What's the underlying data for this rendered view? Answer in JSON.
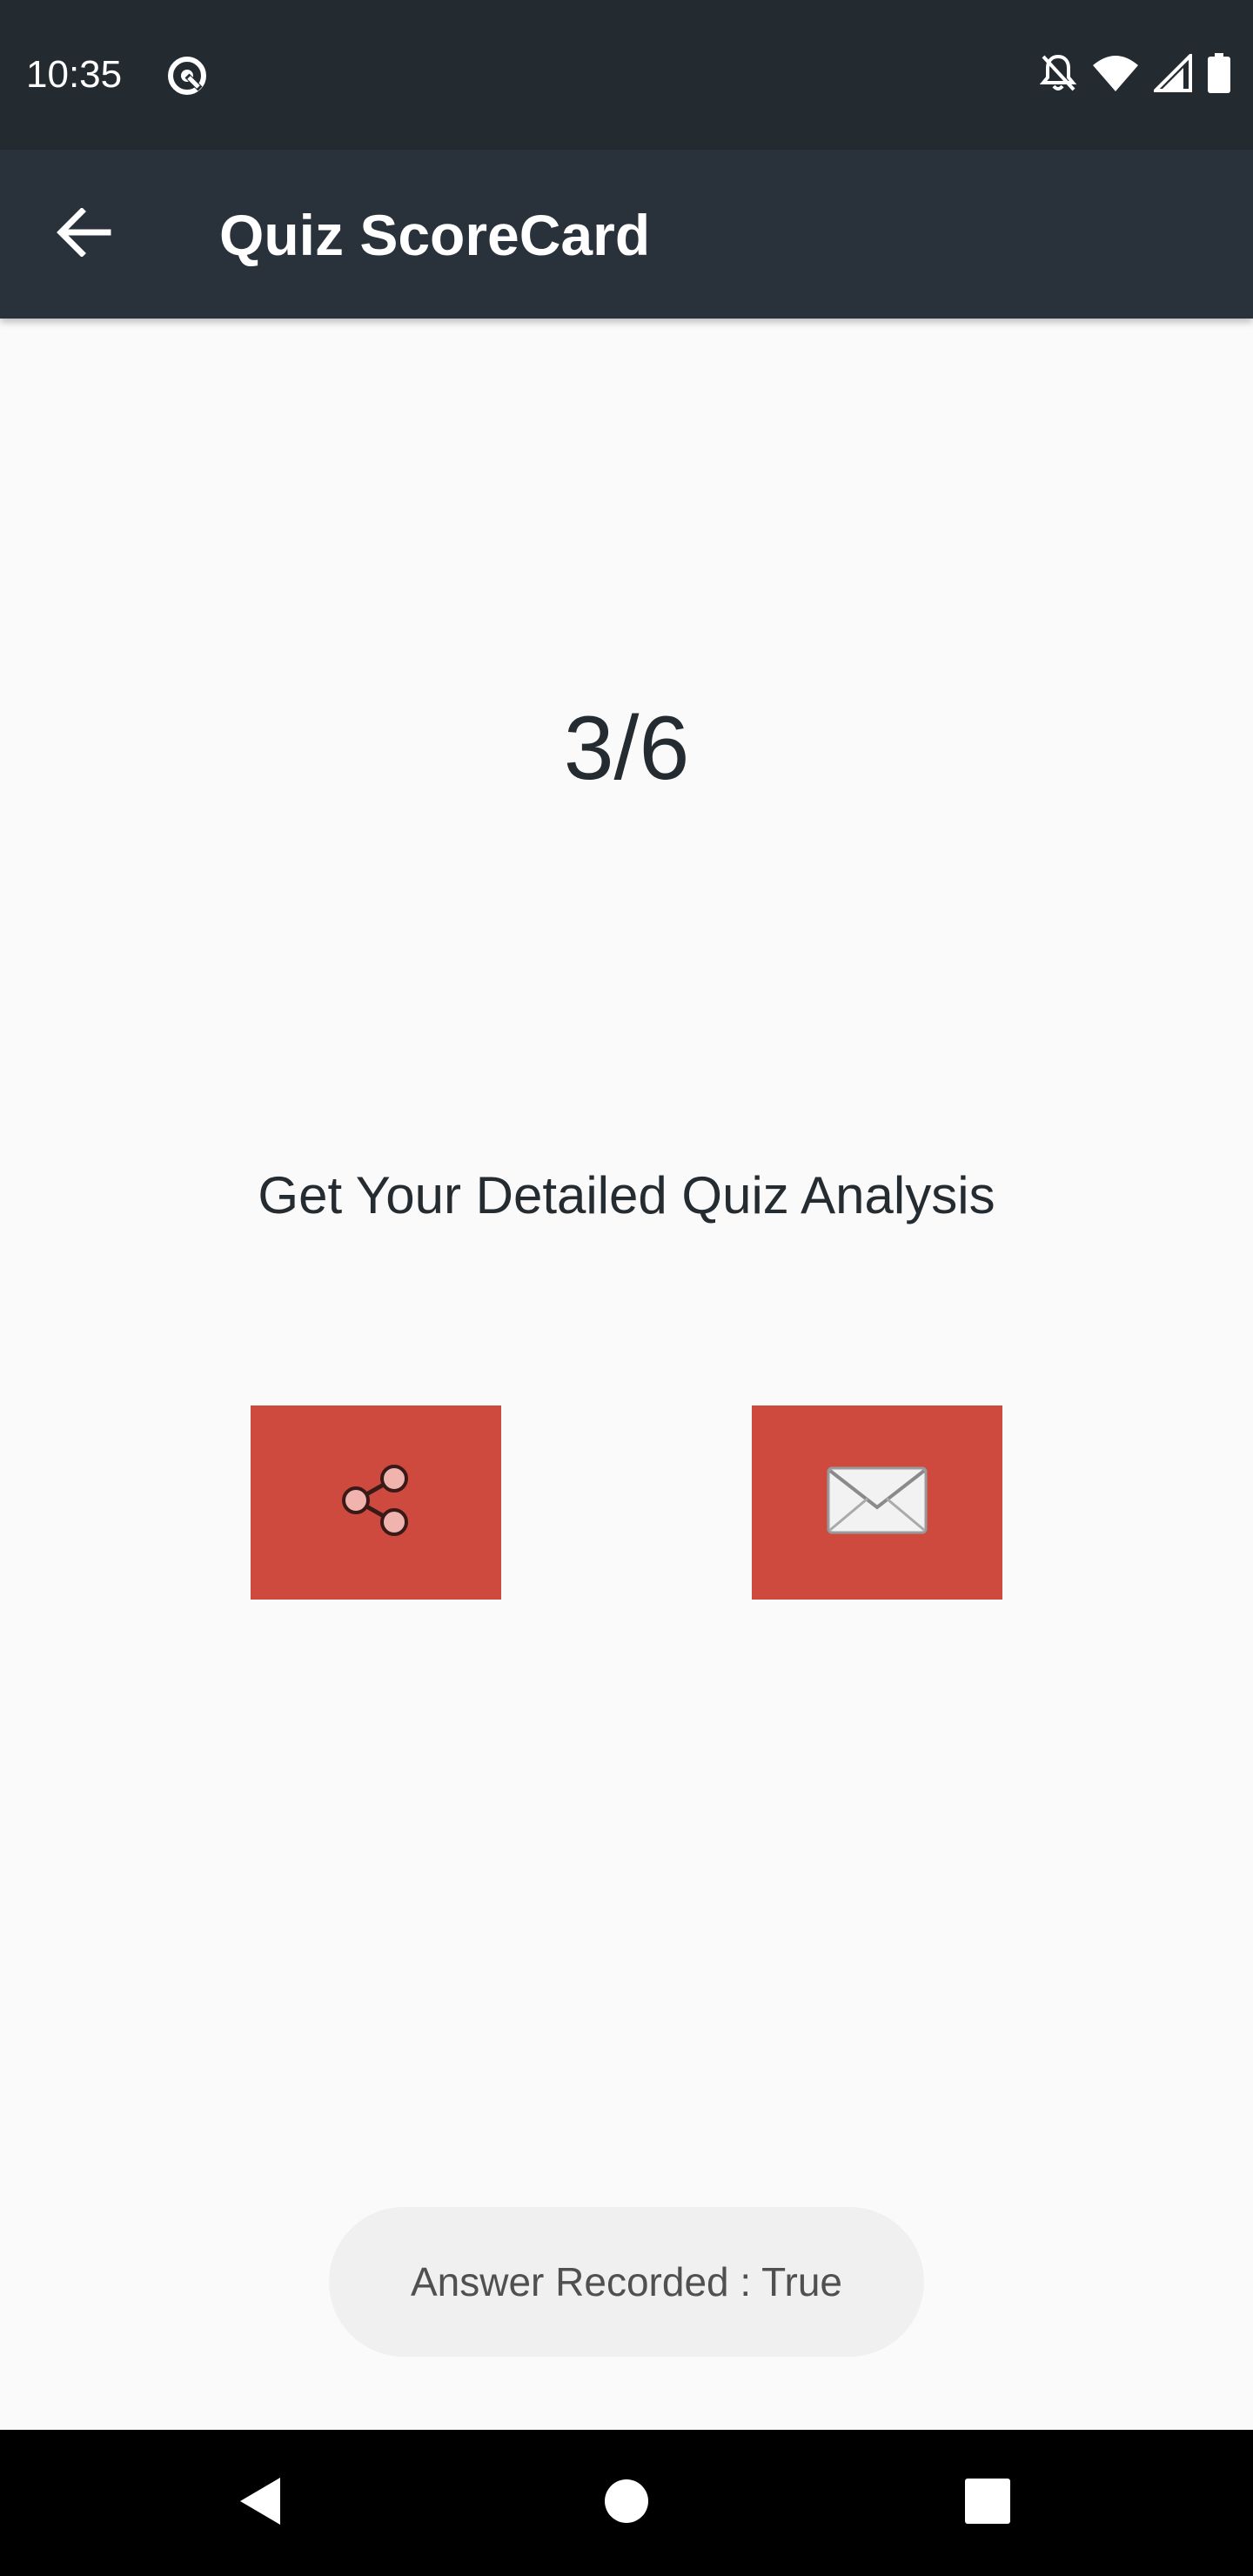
{
  "status_bar": {
    "time": "10:35",
    "icons": [
      "sync-icon",
      "notifications-off-icon",
      "wifi-icon",
      "signal-icon",
      "battery-icon"
    ]
  },
  "app_bar": {
    "back_icon": "arrow-back-icon",
    "title": "Quiz ScoreCard"
  },
  "score": {
    "value": "3/6"
  },
  "analysis": {
    "label": "Get Your Detailed Quiz Analysis"
  },
  "actions": {
    "share_icon": "share-icon",
    "email_icon": "email-envelope-icon"
  },
  "toast": {
    "message": "Answer Recorded : True"
  },
  "nav_bar": {
    "items": [
      "back-triangle-icon",
      "home-circle-icon",
      "recents-square-icon"
    ]
  },
  "colors": {
    "status_bar": "#232a30",
    "app_bar": "#29323a",
    "accent_button": "#cf4a3e",
    "background": "#fafafa",
    "text": "#252c31"
  }
}
